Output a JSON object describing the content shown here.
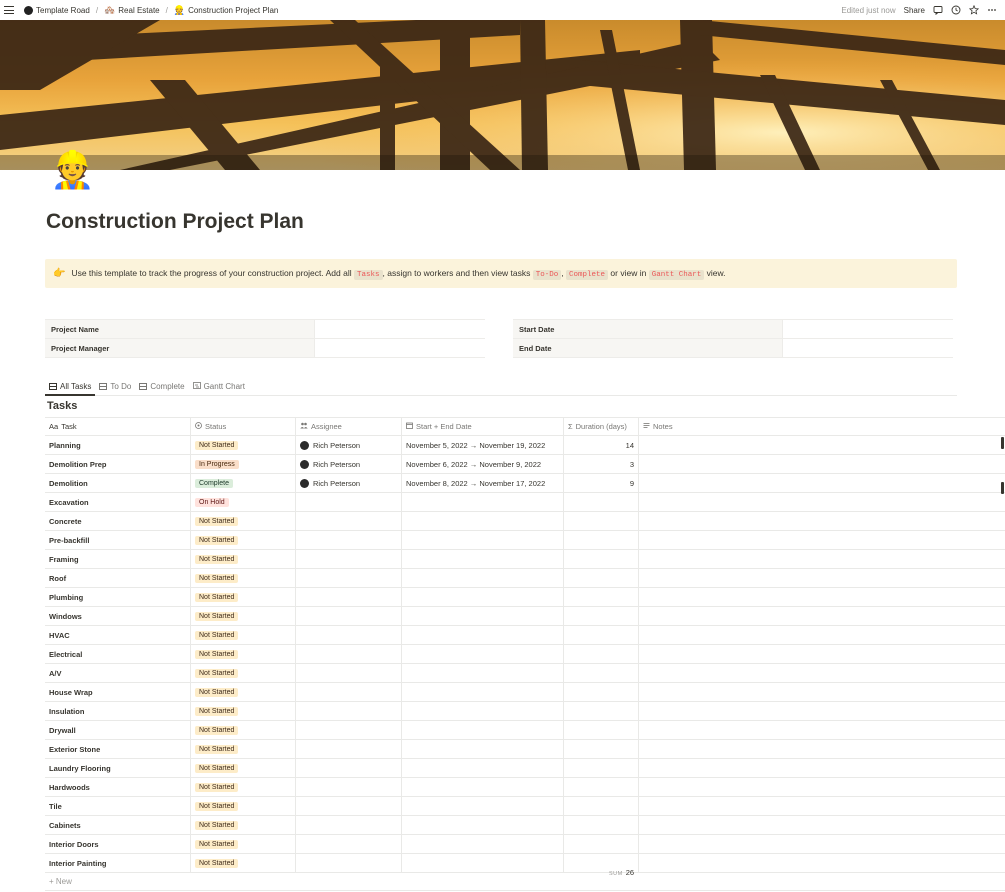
{
  "topbar": {
    "breadcrumbs": [
      {
        "label": "Template Road",
        "icon": "notion-logo-icon"
      },
      {
        "label": "Real Estate",
        "icon": "house-emoji-icon"
      },
      {
        "label": "Construction Project Plan",
        "icon": "construction-worker-emoji-icon"
      }
    ],
    "edited": "Edited just now",
    "share": "Share",
    "icons": [
      "comments-icon",
      "history-icon",
      "star-icon",
      "more-icon"
    ]
  },
  "page": {
    "icon_emoji": "👷",
    "title": "Construction Project Plan"
  },
  "callout": {
    "icon_emoji": "👉",
    "text_1": "Use this template to track the progress of your construction project. Add all",
    "code_1": "Tasks",
    "text_2": ", assign to workers and then view tasks",
    "code_2": "To-Do",
    "text_3": ",",
    "code_3": "Complete",
    "text_4": "or view in",
    "code_4": "Gantt Chart",
    "text_5": "view."
  },
  "properties": {
    "left": [
      {
        "label": "Project Name",
        "value": ""
      },
      {
        "label": "Project Manager",
        "value": ""
      }
    ],
    "right": [
      {
        "label": "Start Date",
        "value": ""
      },
      {
        "label": "End Date",
        "value": ""
      }
    ]
  },
  "views": [
    {
      "label": "All Tasks",
      "active": true
    },
    {
      "label": "To Do",
      "active": false
    },
    {
      "label": "Complete",
      "active": false
    },
    {
      "label": "Gantt Chart",
      "active": false
    }
  ],
  "database": {
    "title": "Tasks",
    "columns": [
      {
        "label": "Task",
        "icon": "Aa"
      },
      {
        "label": "Status",
        "icon": "status-icon"
      },
      {
        "label": "Assignee",
        "icon": "people-icon"
      },
      {
        "label": "Start + End Date",
        "icon": "calendar-icon"
      },
      {
        "label": "Duration (days)",
        "icon": "Σ"
      },
      {
        "label": "Notes",
        "icon": "text-icon"
      }
    ],
    "rows": [
      {
        "task": "Planning",
        "status": "Not Started",
        "assignee": "Rich Peterson",
        "dates": "November 5, 2022 → November 19, 2022",
        "duration": "14",
        "notes": ""
      },
      {
        "task": "Demolition Prep",
        "status": "In Progress",
        "assignee": "Rich Peterson",
        "dates": "November 6, 2022 → November 9, 2022",
        "duration": "3",
        "notes": ""
      },
      {
        "task": "Demolition",
        "status": "Complete",
        "assignee": "Rich Peterson",
        "dates": "November 8, 2022 → November 17, 2022",
        "duration": "9",
        "notes": ""
      },
      {
        "task": "Excavation",
        "status": "On Hold",
        "assignee": "",
        "dates": "",
        "duration": "",
        "notes": ""
      },
      {
        "task": "Concrete",
        "status": "Not Started",
        "assignee": "",
        "dates": "",
        "duration": "",
        "notes": ""
      },
      {
        "task": "Pre-backfill",
        "status": "Not Started",
        "assignee": "",
        "dates": "",
        "duration": "",
        "notes": ""
      },
      {
        "task": "Framing",
        "status": "Not Started",
        "assignee": "",
        "dates": "",
        "duration": "",
        "notes": ""
      },
      {
        "task": "Roof",
        "status": "Not Started",
        "assignee": "",
        "dates": "",
        "duration": "",
        "notes": ""
      },
      {
        "task": "Plumbing",
        "status": "Not Started",
        "assignee": "",
        "dates": "",
        "duration": "",
        "notes": ""
      },
      {
        "task": "Windows",
        "status": "Not Started",
        "assignee": "",
        "dates": "",
        "duration": "",
        "notes": ""
      },
      {
        "task": "HVAC",
        "status": "Not Started",
        "assignee": "",
        "dates": "",
        "duration": "",
        "notes": ""
      },
      {
        "task": "Electrical",
        "status": "Not Started",
        "assignee": "",
        "dates": "",
        "duration": "",
        "notes": ""
      },
      {
        "task": "A/V",
        "status": "Not Started",
        "assignee": "",
        "dates": "",
        "duration": "",
        "notes": ""
      },
      {
        "task": "House Wrap",
        "status": "Not Started",
        "assignee": "",
        "dates": "",
        "duration": "",
        "notes": ""
      },
      {
        "task": "Insulation",
        "status": "Not Started",
        "assignee": "",
        "dates": "",
        "duration": "",
        "notes": ""
      },
      {
        "task": "Drywall",
        "status": "Not Started",
        "assignee": "",
        "dates": "",
        "duration": "",
        "notes": ""
      },
      {
        "task": "Exterior Stone",
        "status": "Not Started",
        "assignee": "",
        "dates": "",
        "duration": "",
        "notes": ""
      },
      {
        "task": "Laundry Flooring",
        "status": "Not Started",
        "assignee": "",
        "dates": "",
        "duration": "",
        "notes": ""
      },
      {
        "task": "Hardwoods",
        "status": "Not Started",
        "assignee": "",
        "dates": "",
        "duration": "",
        "notes": ""
      },
      {
        "task": "Tile",
        "status": "Not Started",
        "assignee": "",
        "dates": "",
        "duration": "",
        "notes": ""
      },
      {
        "task": "Cabinets",
        "status": "Not Started",
        "assignee": "",
        "dates": "",
        "duration": "",
        "notes": ""
      },
      {
        "task": "Interior Doors",
        "status": "Not Started",
        "assignee": "",
        "dates": "",
        "duration": "",
        "notes": ""
      },
      {
        "task": "Interior Painting",
        "status": "Not Started",
        "assignee": "",
        "dates": "",
        "duration": "",
        "notes": ""
      }
    ],
    "new_label": "+ New",
    "sum_label": "SUM",
    "sum_value": "26"
  },
  "status_colors": {
    "Not Started": {
      "bg": "#fdecc8",
      "fg": "#402c1b"
    },
    "In Progress": {
      "bg": "#fadec9",
      "fg": "#49290e"
    },
    "Complete": {
      "bg": "#dbeddb",
      "fg": "#1c3829"
    },
    "On Hold": {
      "bg": "#ffe2dd",
      "fg": "#5d1715"
    }
  }
}
